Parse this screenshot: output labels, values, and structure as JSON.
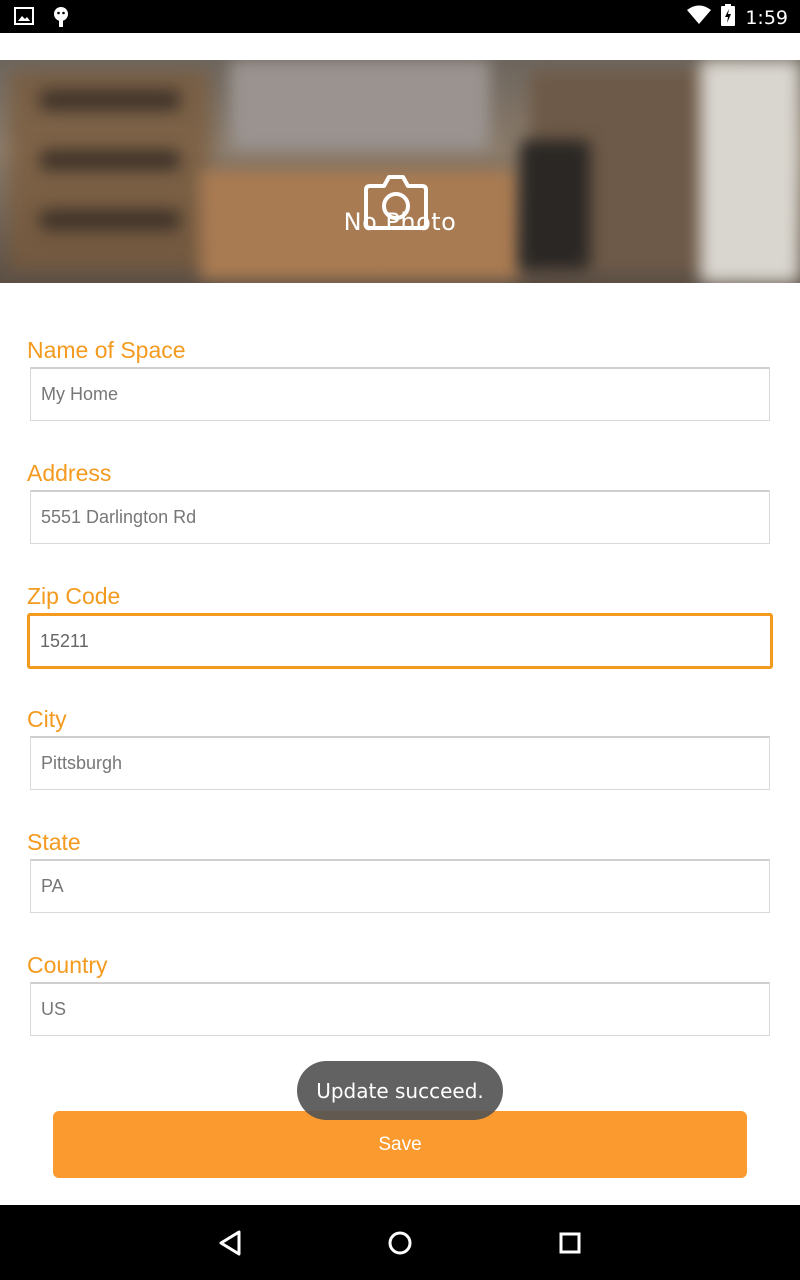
{
  "status_bar": {
    "time": "1:59",
    "icons": [
      "image-icon",
      "android-icon",
      "wifi-icon",
      "battery-charging-icon"
    ]
  },
  "header": {
    "no_photo_label": "No Photo",
    "camera_icon": "camera-icon"
  },
  "form": {
    "name_of_space": {
      "label": "Name of Space",
      "value": "My Home"
    },
    "address": {
      "label": "Address",
      "value": "5551 Darlington Rd"
    },
    "zip_code": {
      "label": "Zip Code",
      "value": "15211"
    },
    "city": {
      "label": "City",
      "value": "Pittsburgh"
    },
    "state": {
      "label": "State",
      "value": "PA"
    },
    "country": {
      "label": "Country",
      "value": "US"
    }
  },
  "save_label": "Save",
  "toast": "Update succeed.",
  "nav": [
    "back-icon",
    "home-icon",
    "recents-icon"
  ],
  "colors": {
    "accent": "#f39a1f",
    "button": "#fb9a2e"
  }
}
